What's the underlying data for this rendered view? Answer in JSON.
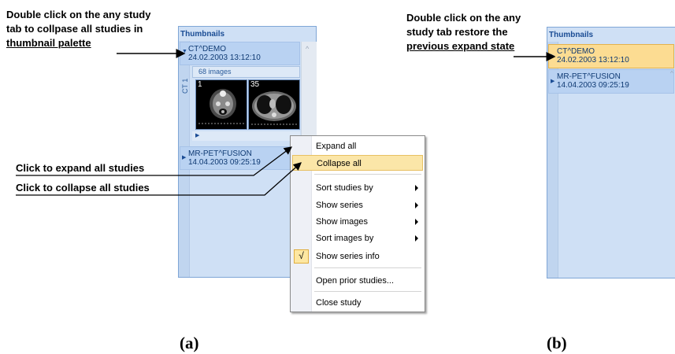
{
  "annotations": {
    "a_top": [
      "Double click on the any study",
      "tab to collpase all studies in",
      "thumbnail palette"
    ],
    "a_expand": "Click to expand all studies",
    "a_collapse": "Click to collapse all studies",
    "b_top": [
      "Double click on the any",
      "study tab restore the",
      "previous expand state"
    ]
  },
  "captions": {
    "a": "(a)",
    "b": "(b)"
  },
  "palette_a": {
    "title": "Thumbnails",
    "study1": {
      "name": "CT^DEMO",
      "date": "24.02.2003 13:12:10"
    },
    "series": {
      "label": "CT 1",
      "count": "68 images",
      "thumbs": [
        "1",
        "35"
      ]
    },
    "study2": {
      "name": "MR-PET^FUSION",
      "date": "14.04.2003 09:25:19"
    }
  },
  "palette_b": {
    "title": "Thumbnails",
    "study1": {
      "name": "CT^DEMO",
      "date": "24.02.2003 13:12:10"
    },
    "study2": {
      "name": "MR-PET^FUSION",
      "date": "14.04.2003 09:25:19"
    }
  },
  "menu": {
    "items": [
      {
        "label": "Expand all"
      },
      {
        "label": "Collapse all"
      },
      {
        "label": "Sort studies by"
      },
      {
        "label": "Show series"
      },
      {
        "label": "Show images"
      },
      {
        "label": "Sort images by"
      },
      {
        "label": "Show series info"
      },
      {
        "label": "Open prior studies..."
      },
      {
        "label": "Close study"
      }
    ],
    "check_glyph": "√",
    "highlighted": "Collapse all",
    "checked": "Show series info"
  },
  "colors": {
    "tab_bg": "#b9d2f2",
    "tab_highlight": "#fcdc92",
    "palette_bg": "#cfe0f5",
    "menu_highlight": "#fbe6a8"
  }
}
